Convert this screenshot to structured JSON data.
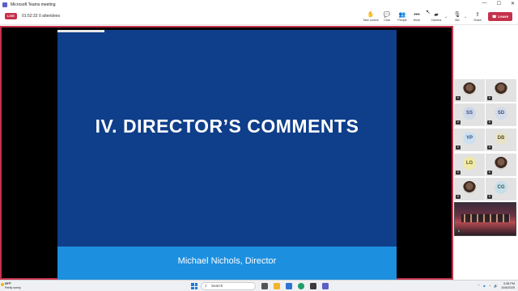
{
  "window": {
    "title": "Microsoft Teams meeting",
    "controls": [
      "—",
      "☐",
      "✕"
    ]
  },
  "meeting": {
    "rec_label": "LIVE",
    "timer": "01:52:33",
    "attendees": "0 attendees",
    "toolbar": [
      {
        "id": "take-control",
        "label": "Take control",
        "icon": "✋"
      },
      {
        "id": "chat",
        "label": "Chat",
        "icon": "💬"
      },
      {
        "id": "people",
        "label": "People",
        "icon": "👥"
      },
      {
        "id": "more",
        "label": "More",
        "icon": "•••"
      },
      {
        "id": "camera",
        "label": "Camera",
        "icon": "▰"
      },
      {
        "id": "mic",
        "label": "Mic",
        "icon": "🎙"
      },
      {
        "id": "share",
        "label": "Share",
        "icon": "⇪"
      }
    ],
    "leave_label": "Leave"
  },
  "slide": {
    "heading": "IV. DIRECTOR’S COMMENTS",
    "subtitle": "Michael Nichols, Director",
    "colors": {
      "main": "#0f3e8a",
      "footer": "#1c8fdf"
    }
  },
  "participants": [
    {
      "initials": "",
      "photo": true,
      "bg": "#ffffff"
    },
    {
      "initials": "",
      "photo": true,
      "bg": "#ffffff"
    },
    {
      "initials": "SS",
      "photo": false,
      "bg": "#cfd8ea",
      "fg": "#3b4d7a"
    },
    {
      "initials": "SD",
      "photo": false,
      "bg": "#d4dbe9",
      "fg": "#3b4d7a"
    },
    {
      "initials": "YP",
      "photo": false,
      "bg": "#cce0f1",
      "fg": "#2c4f79"
    },
    {
      "initials": "DB",
      "photo": false,
      "bg": "#e7e3c9",
      "fg": "#5a5320"
    },
    {
      "initials": "LG",
      "photo": false,
      "bg": "#f0e9a8",
      "fg": "#5a5320"
    },
    {
      "initials": "",
      "photo": true,
      "bg": "#ffffff"
    },
    {
      "initials": "",
      "photo": true,
      "bg": "#ffffff"
    },
    {
      "initials": "CG",
      "photo": false,
      "bg": "#c9dfe7",
      "fg": "#2c5560"
    }
  ],
  "taskbar": {
    "weather_temp": "69°F",
    "weather_desc": "Partly sunny",
    "search_placeholder": "Search",
    "time": "3:38 PM",
    "date": "10/8/2025"
  }
}
